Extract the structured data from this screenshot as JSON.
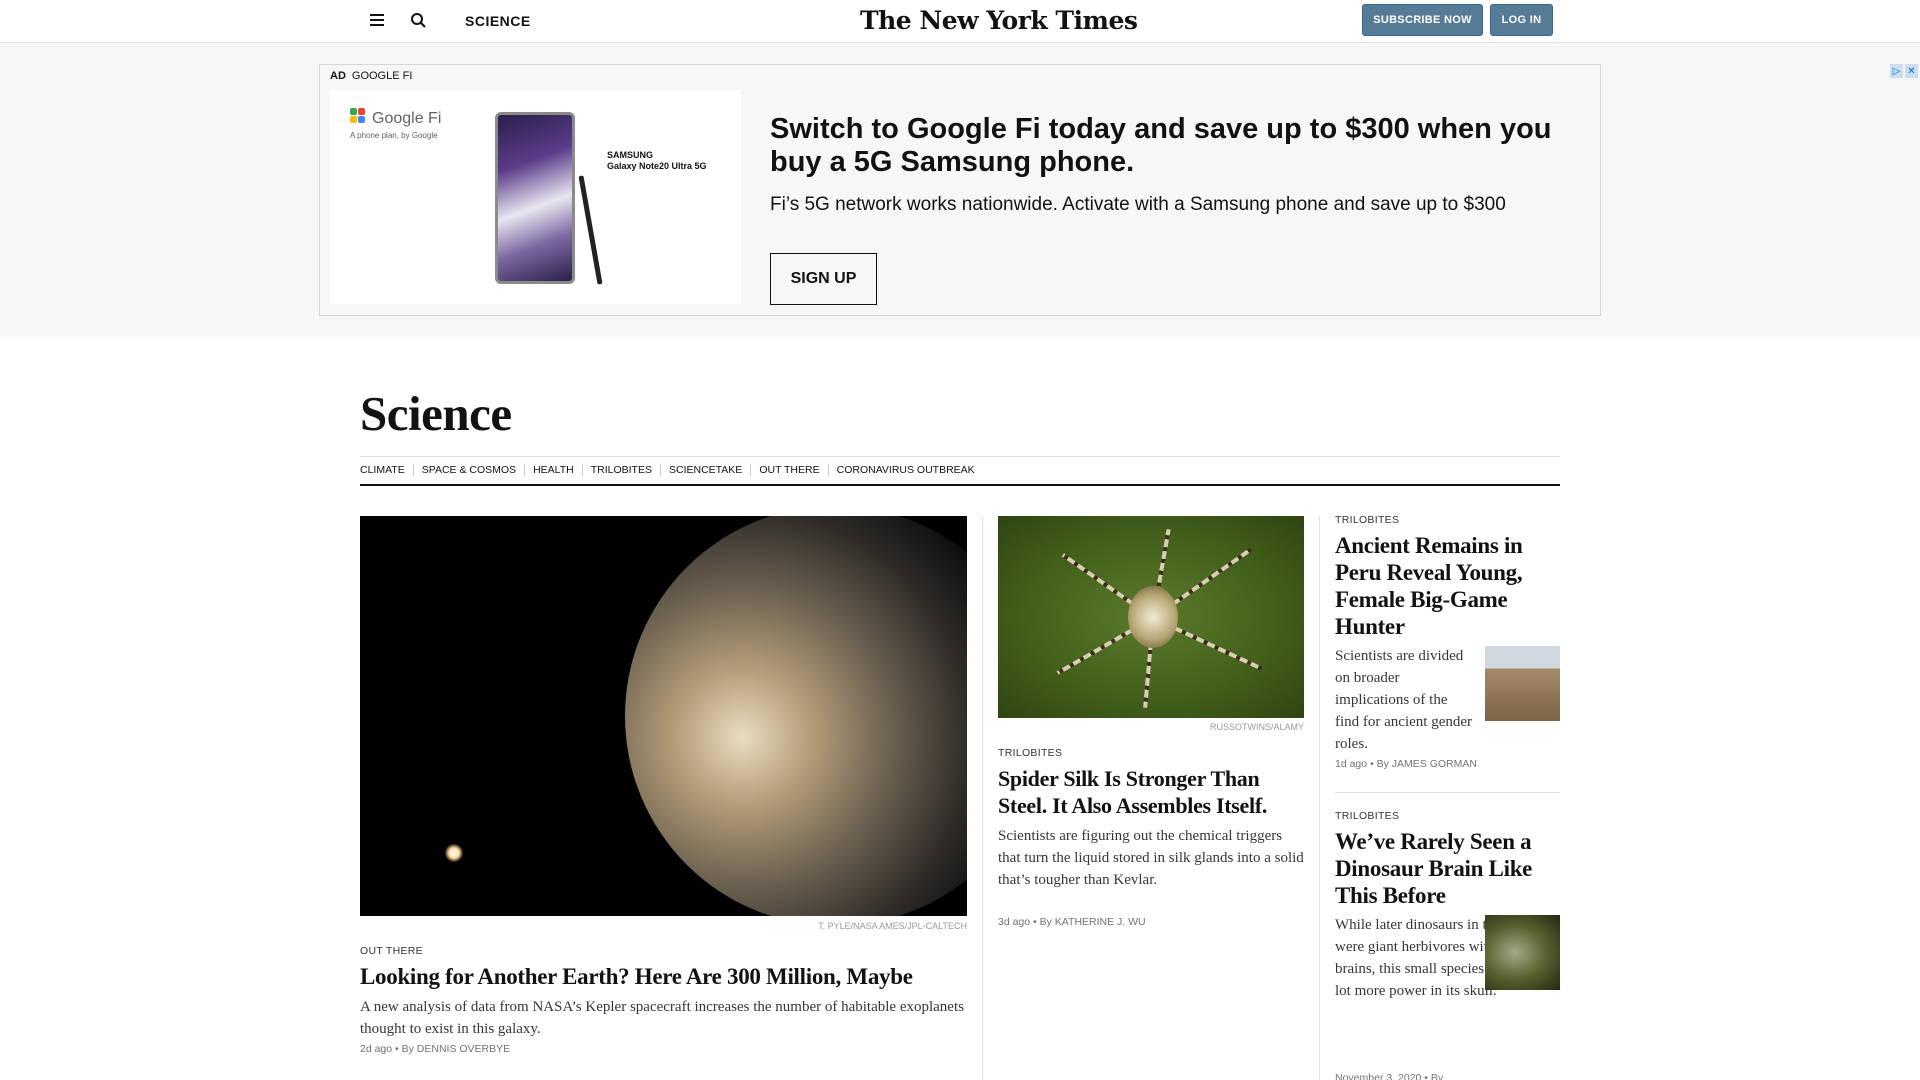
{
  "header": {
    "section_label": "SCIENCE",
    "logo_text": "The New York Times",
    "subscribe_label": "SUBSCRIBE NOW",
    "login_label": "LOG IN"
  },
  "ad": {
    "ad_tag": "AD",
    "advertiser": "GOOGLE FI",
    "brand_logo": "Google Fi",
    "brand_tagline": "A phone plan, by Google",
    "product_brand": "SAMSUNG",
    "product_name": "Galaxy Note20 Ultra 5G",
    "headline": "Switch to Google Fi today and save up to $300 when you buy a 5G Samsung phone.",
    "body": "Fi’s 5G network works nationwide. Activate with a Samsung phone and save up to $300",
    "cta": "SIGN UP",
    "close_glyph_1": "▷",
    "close_glyph_2": "✕"
  },
  "page": {
    "title": "Science",
    "subnav": [
      "CLIMATE",
      "SPACE & COSMOS",
      "HEALTH",
      "TRILOBITES",
      "SCIENCETAKE",
      "OUT THERE",
      "CORONAVIRUS OUTBREAK"
    ]
  },
  "stories": [
    {
      "credit": "T. PYLE/NASA AMES/JPL-CALTECH",
      "kicker": "OUT THERE",
      "headline": "Looking for Another Earth? Here Are 300 Million, Maybe",
      "summary": "A new analysis of data from NASA’s Kepler spacecraft increases the number of habitable exoplanets thought to exist in this galaxy.",
      "meta": "2d ago  •  By DENNIS OVERBYE"
    },
    {
      "credit": "RUSSOTWINS/ALAMY",
      "kicker": "TRILOBITES",
      "headline": "Spider Silk Is Stronger Than Steel. It Also Assembles Itself.",
      "summary": "Scientists are figuring out the chemical triggers that turn the liquid stored in silk glands into a solid that’s tougher than Kevlar.",
      "meta": "3d ago  •  By KATHERINE J. WU"
    },
    {
      "kicker": "TRILOBITES",
      "headline": "Ancient Remains in Peru Reveal Young, Female Big-Game Hunter",
      "summary": "Scientists are divided on broader implications of the find for ancient gender roles.",
      "meta": "1d ago  •  By JAMES GORMAN"
    },
    {
      "kicker": "TRILOBITES",
      "headline": "We’ve Rarely Seen a Dinosaur Brain Like This Before",
      "summary": "While later dinosaurs in this lineage were giant herbivores with tiny brains, this small species packed a lot more power in its skull.",
      "meta": "November 3, 2020  •  By"
    }
  ]
}
